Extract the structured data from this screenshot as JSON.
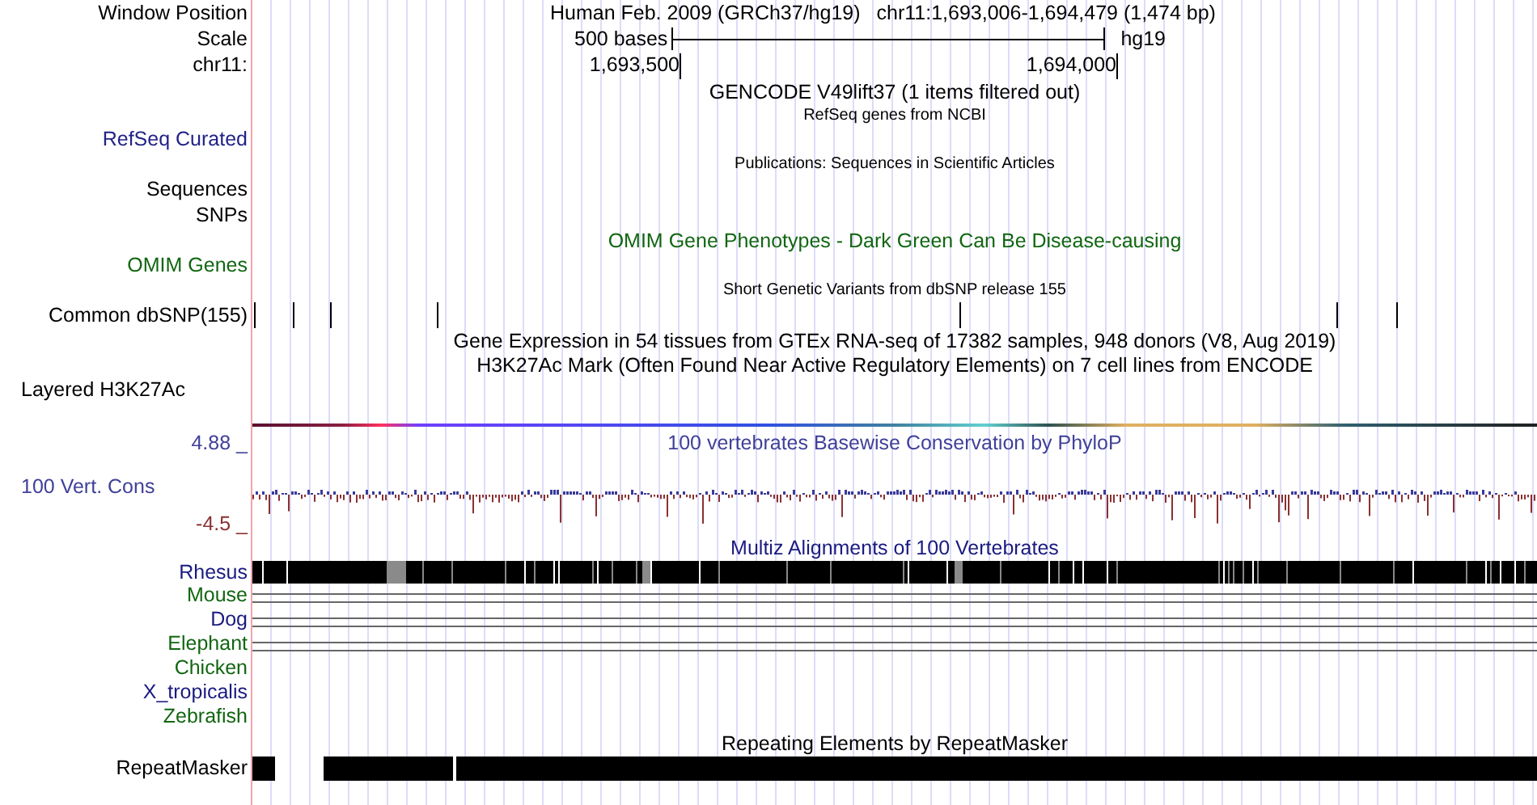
{
  "header": {
    "position_label": "Window Position",
    "assembly_title": "Human Feb. 2009 (GRCh37/hg19)",
    "range": "chr11:1,693,006-1,694,479 (1,474 bp)",
    "scale_label": "Scale",
    "scale_length": "500 bases",
    "assembly": "hg19",
    "chrom_label": "chr11:",
    "ticks": [
      "1,693,500",
      "1,694,000"
    ]
  },
  "gencode": {
    "title": "GENCODE V49lift37 (1 items filtered out)"
  },
  "refseq": {
    "title": "RefSeq genes from NCBI",
    "label": "RefSeq Curated"
  },
  "publications": {
    "title": "Publications: Sequences in Scientific Articles",
    "labels": [
      "Sequences",
      "SNPs"
    ]
  },
  "omim": {
    "title": "OMIM Gene Phenotypes - Dark Green Can Be Disease-causing",
    "label": "OMIM Genes"
  },
  "dbsnp": {
    "title": "Short Genetic Variants from dbSNP release 155",
    "label": "Common dbSNP(155)"
  },
  "gtex": {
    "title": "Gene Expression in 54 tissues from GTEx RNA-seq of 17382 samples, 948 donors (V8, Aug 2019)"
  },
  "h3k27ac": {
    "title": "H3K27Ac Mark (Often Found Near Active Regulatory Elements) on 7 cell lines from ENCODE",
    "label": "Layered H3K27Ac"
  },
  "conservation": {
    "title": "100 vertebrates Basewise Conservation by PhyloP",
    "label": "100 Vert. Cons",
    "max": "4.88 _",
    "min": "-4.5 _"
  },
  "multiz": {
    "title": "Multiz Alignments of 100 Vertebrates",
    "species": [
      {
        "name": "Rhesus",
        "color": "#1a1a80",
        "kind": "blocks"
      },
      {
        "name": "Mouse",
        "color": "#116611",
        "kind": "lines"
      },
      {
        "name": "Dog",
        "color": "#1a1a80",
        "kind": "lines"
      },
      {
        "name": "Elephant",
        "color": "#116611",
        "kind": "lines"
      },
      {
        "name": "Chicken",
        "color": "#116611",
        "kind": "empty"
      },
      {
        "name": "X_tropicalis",
        "color": "#1a1a80",
        "kind": "empty"
      },
      {
        "name": "Zebrafish",
        "color": "#116611",
        "kind": "empty"
      }
    ]
  },
  "repeatmasker": {
    "title": "Repeating Elements by RepeatMasker",
    "label": "RepeatMasker"
  }
}
